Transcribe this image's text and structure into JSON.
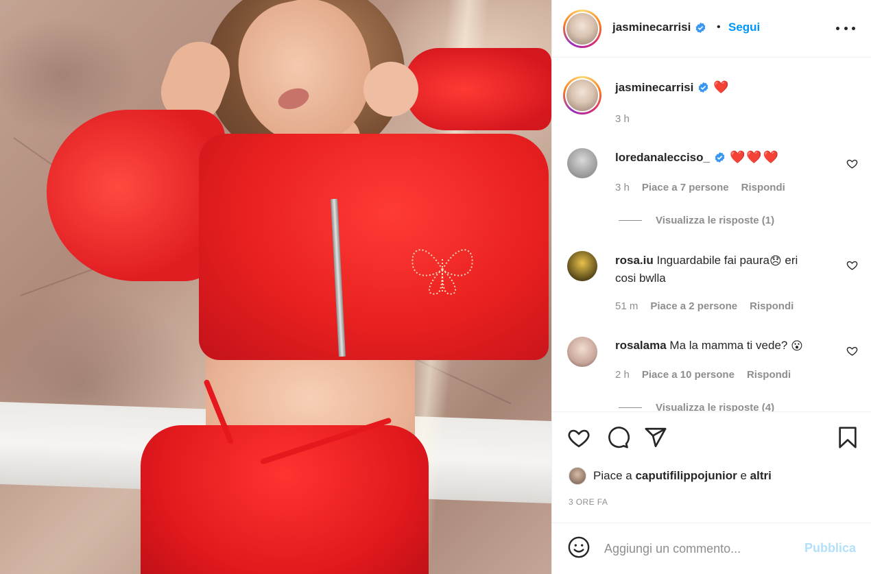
{
  "post_header": {
    "username": "jasminecarrisi",
    "verified_icon": "verified-badge-icon",
    "separator": "•",
    "follow_label": "Segui",
    "more_icon": "more-options-icon"
  },
  "caption": {
    "username": "jasminecarrisi",
    "emoji": "❤️",
    "time": "3 h"
  },
  "comments": [
    {
      "username": "loredanalecciso_",
      "verified": true,
      "text": "❤️❤️❤️",
      "time": "3 h",
      "likes": "Piace a 7 persone",
      "reply": "Rispondi",
      "view_replies": "Visualizza le risposte (1)"
    },
    {
      "username": "rosa.iu",
      "verified": false,
      "text": "Inguardabile fai paura",
      "emoji": "😞",
      "text_after": " eri",
      "text_line2": "cosi bwlla",
      "time": "51 m",
      "likes": "Piace a 2 persone",
      "reply": "Rispondi"
    },
    {
      "username": "rosalama",
      "verified": false,
      "text": "Ma la mamma ti vede?",
      "emoji": "😮",
      "time": "2 h",
      "likes": "Piace a 10 persone",
      "reply": "Rispondi",
      "view_replies": "Visualizza le risposte (4)"
    }
  ],
  "actions": {
    "like_icon": "heart-icon",
    "comment_icon": "comment-icon",
    "share_icon": "share-icon",
    "save_icon": "bookmark-icon"
  },
  "likes_line": {
    "prefix": "Piace a",
    "user": "caputifilippojunior",
    "conjunction": "e",
    "others": "altri"
  },
  "posted_ago": "3 ORE FA",
  "add_comment": {
    "emoji_icon": "emoji-picker-icon",
    "placeholder": "Aggiungi un commento...",
    "publish_label": "Pubblica"
  },
  "colors": {
    "accent_blue": "#0095f6",
    "publish_disabled": "#b2dffc",
    "heart_red": "#ed4956",
    "muted_text": "#8e8e8e"
  }
}
